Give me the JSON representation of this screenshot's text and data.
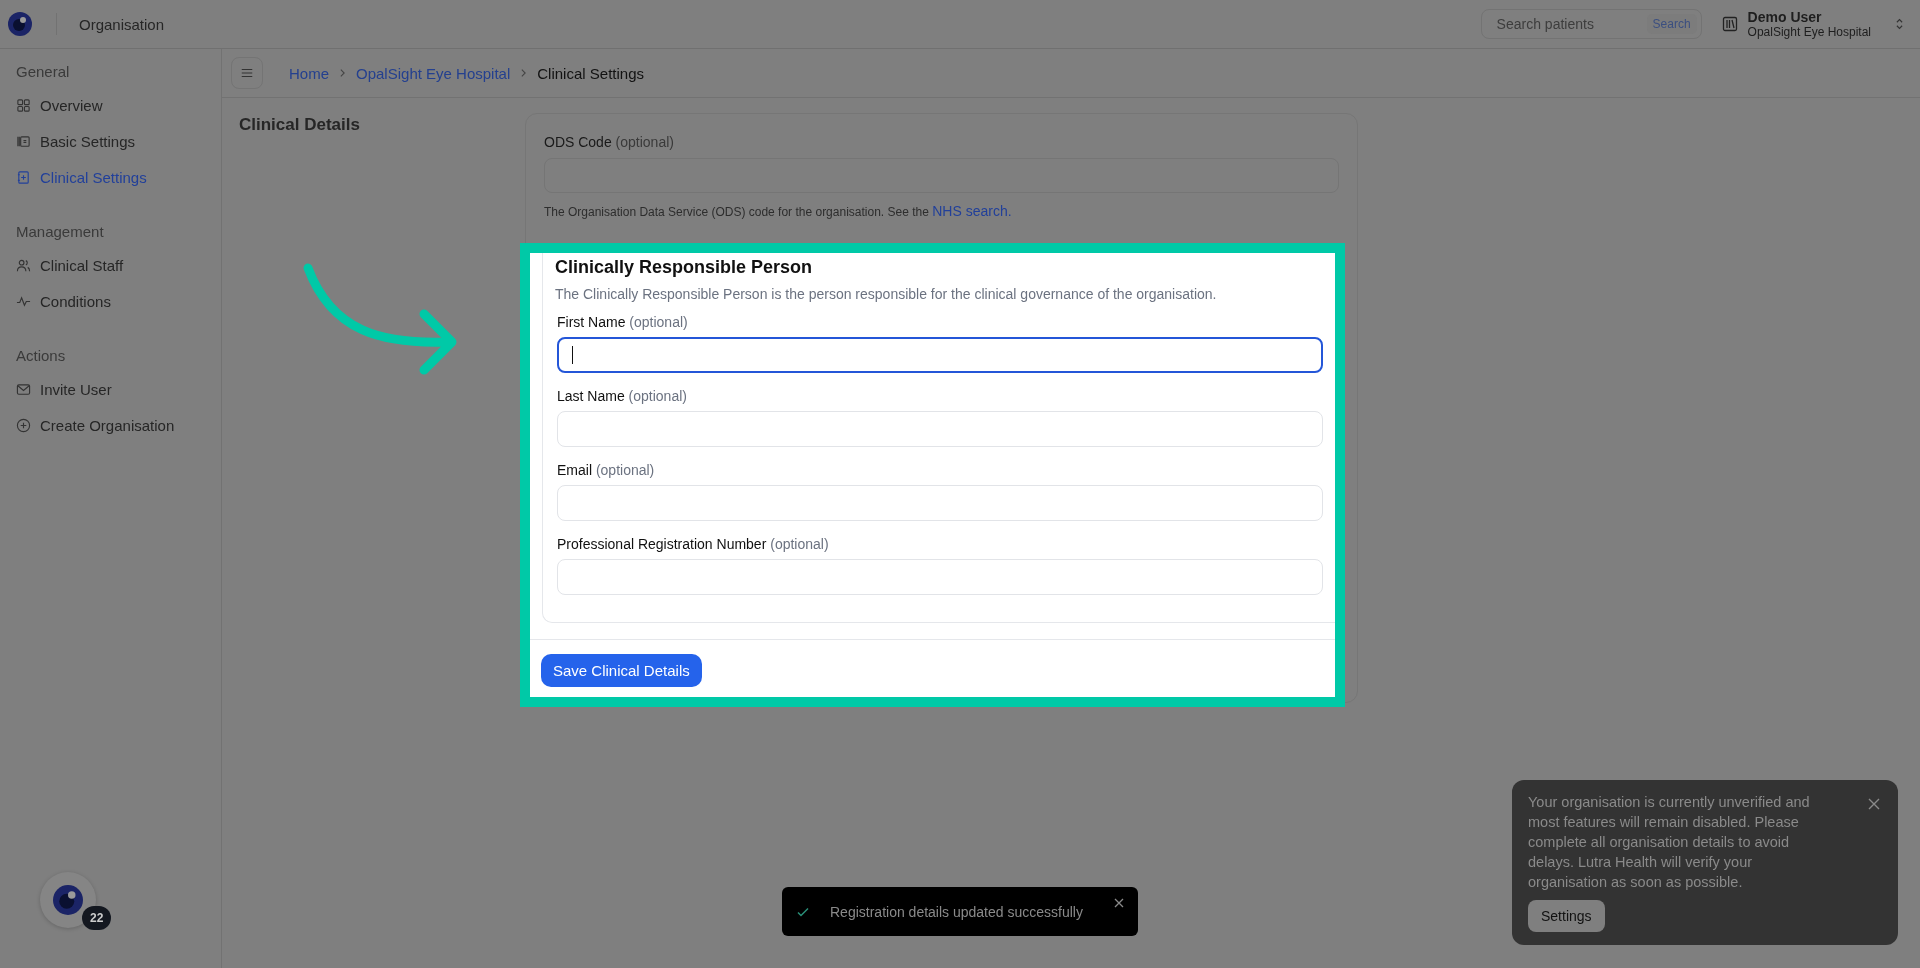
{
  "topbar": {
    "title": "Organisation",
    "search": {
      "placeholder": "Search patients",
      "button": "Search"
    },
    "user": {
      "name": "Demo User",
      "organisation": "OpalSight Eye Hospital"
    }
  },
  "sidebar": {
    "sections": [
      {
        "title": "General",
        "items": [
          {
            "label": "Overview",
            "selected": false
          },
          {
            "label": "Basic Settings",
            "selected": false
          },
          {
            "label": "Clinical Settings",
            "selected": true
          }
        ]
      },
      {
        "title": "Management",
        "items": [
          {
            "label": "Clinical Staff",
            "selected": false
          },
          {
            "label": "Conditions",
            "selected": false
          }
        ]
      },
      {
        "title": "Actions",
        "items": [
          {
            "label": "Invite User",
            "selected": false
          },
          {
            "label": "Create Organisation",
            "selected": false
          }
        ]
      }
    ]
  },
  "breadcrumb": [
    {
      "label": "Home",
      "current": false
    },
    {
      "label": "OpalSight Eye Hospital",
      "current": false
    },
    {
      "label": "Clinical Settings",
      "current": true
    }
  ],
  "page_title": "Clinical Details",
  "ods": {
    "label": "ODS Code",
    "hint": "(optional)",
    "help": "The Organisation Data Service (ODS) code for the organisation. See the",
    "link": "NHS search."
  },
  "crp": {
    "title": "Clinically Responsible Person",
    "description": "The Clinically Responsible Person is the person responsible for the clinical governance of the organisation.",
    "fields": [
      {
        "label": "First Name",
        "hint": "(optional)",
        "focused": true
      },
      {
        "label": "Last Name",
        "hint": "(optional)",
        "focused": false
      },
      {
        "label": "Email",
        "hint": "(optional)",
        "focused": false
      },
      {
        "label": "Professional Registration Number",
        "hint": "(optional)",
        "focused": false
      }
    ]
  },
  "save_button": "Save Clinical Details",
  "toast": {
    "message": "Registration details updated successfully"
  },
  "notice": {
    "message": "Your organisation is currently unverified and most features will remain disabled. Please complete all organisation details to avoid delays. Lutra Health will verify your organisation as soon as possible.",
    "button": "Settings"
  },
  "help_badge": {
    "count": "22"
  }
}
